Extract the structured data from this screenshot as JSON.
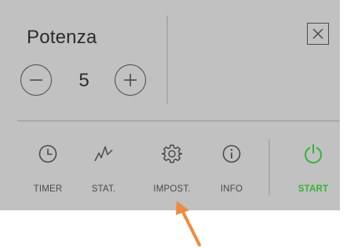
{
  "power": {
    "title": "Potenza",
    "value": "5",
    "decrease_icon": "minus-icon",
    "increase_icon": "plus-icon"
  },
  "close_icon": "close-icon",
  "toolbar": {
    "items": [
      {
        "label": "TIMER",
        "icon": "clock-icon"
      },
      {
        "label": "STAT.",
        "icon": "stats-chart-icon"
      },
      {
        "label": "IMPOST.",
        "icon": "gear-icon"
      },
      {
        "label": "INFO",
        "icon": "info-icon"
      },
      {
        "label": "START",
        "icon": "power-icon"
      }
    ]
  },
  "colors": {
    "panel_background": "#c1c1c1",
    "icon": "#4a4a4a",
    "start_accent": "#33b533",
    "annotation_arrow": "#f08a3c"
  },
  "annotation": {
    "arrow_points_to": "IMPOST."
  }
}
